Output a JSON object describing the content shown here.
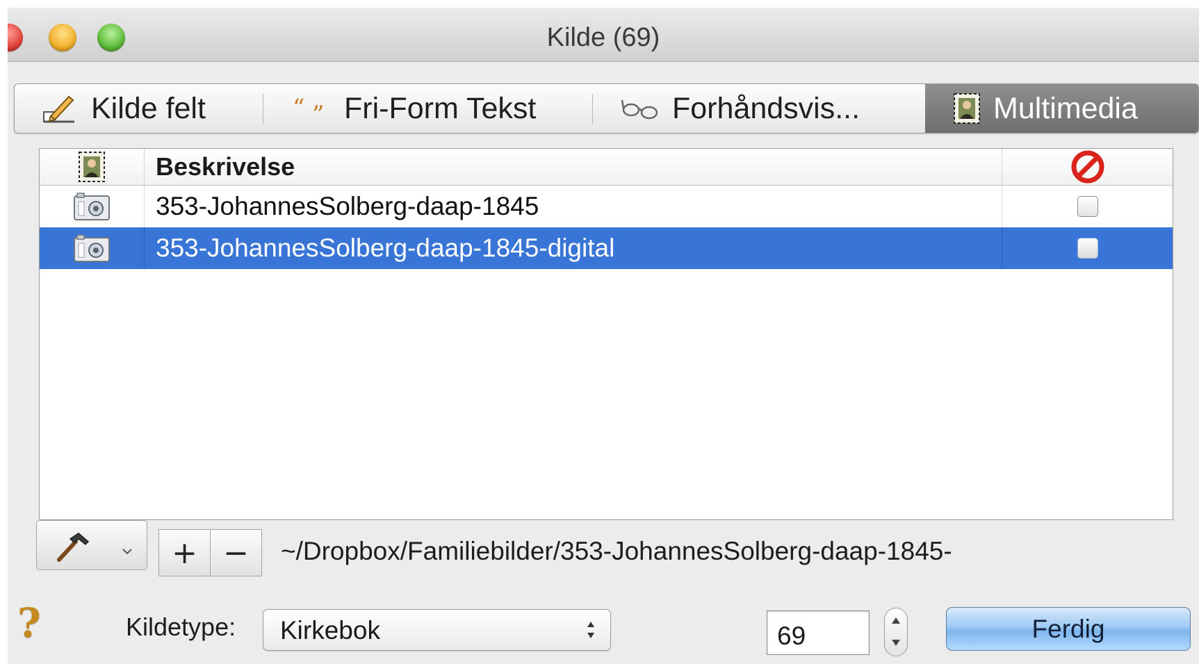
{
  "window": {
    "title": "Kilde (69)"
  },
  "tabs": [
    {
      "label": "Kilde felt",
      "icon": "pencil-icon",
      "selected": false
    },
    {
      "label": "Fri-Form Tekst",
      "icon": "quote-icon",
      "selected": false
    },
    {
      "label": "Forhåndsvis...",
      "icon": "glasses-icon",
      "selected": false
    },
    {
      "label": "Multimedia",
      "icon": "portrait-icon",
      "selected": true
    }
  ],
  "table": {
    "header": {
      "icon": "portrait-icon",
      "description": "Beskrivelse",
      "exclude_icon": "prohibited-icon"
    },
    "rows": [
      {
        "icon": "camera-icon",
        "description": "353-JohannesSolberg-daap-1845",
        "checked": false,
        "selected": false
      },
      {
        "icon": "camera-icon",
        "description": "353-JohannesSolberg-daap-1845-digital",
        "checked": false,
        "selected": true
      }
    ]
  },
  "toolbar": {
    "action_icon": "hammer-icon",
    "add_label": "+",
    "remove_label": "−",
    "path": "~/Dropbox/Familiebilder/353-JohannesSolberg-daap-1845-"
  },
  "footer": {
    "help_label": "?",
    "kildetype_label": "Kildetype:",
    "kildetype_value": "Kirkebok",
    "number_value": "69",
    "done_label": "Ferdig"
  },
  "colors": {
    "selection": "#3875d7",
    "selected_tab": "#7d7d7d",
    "prohibited": "#d9241b",
    "help": "#c48a1e",
    "done_button": "#9fcaf4"
  }
}
